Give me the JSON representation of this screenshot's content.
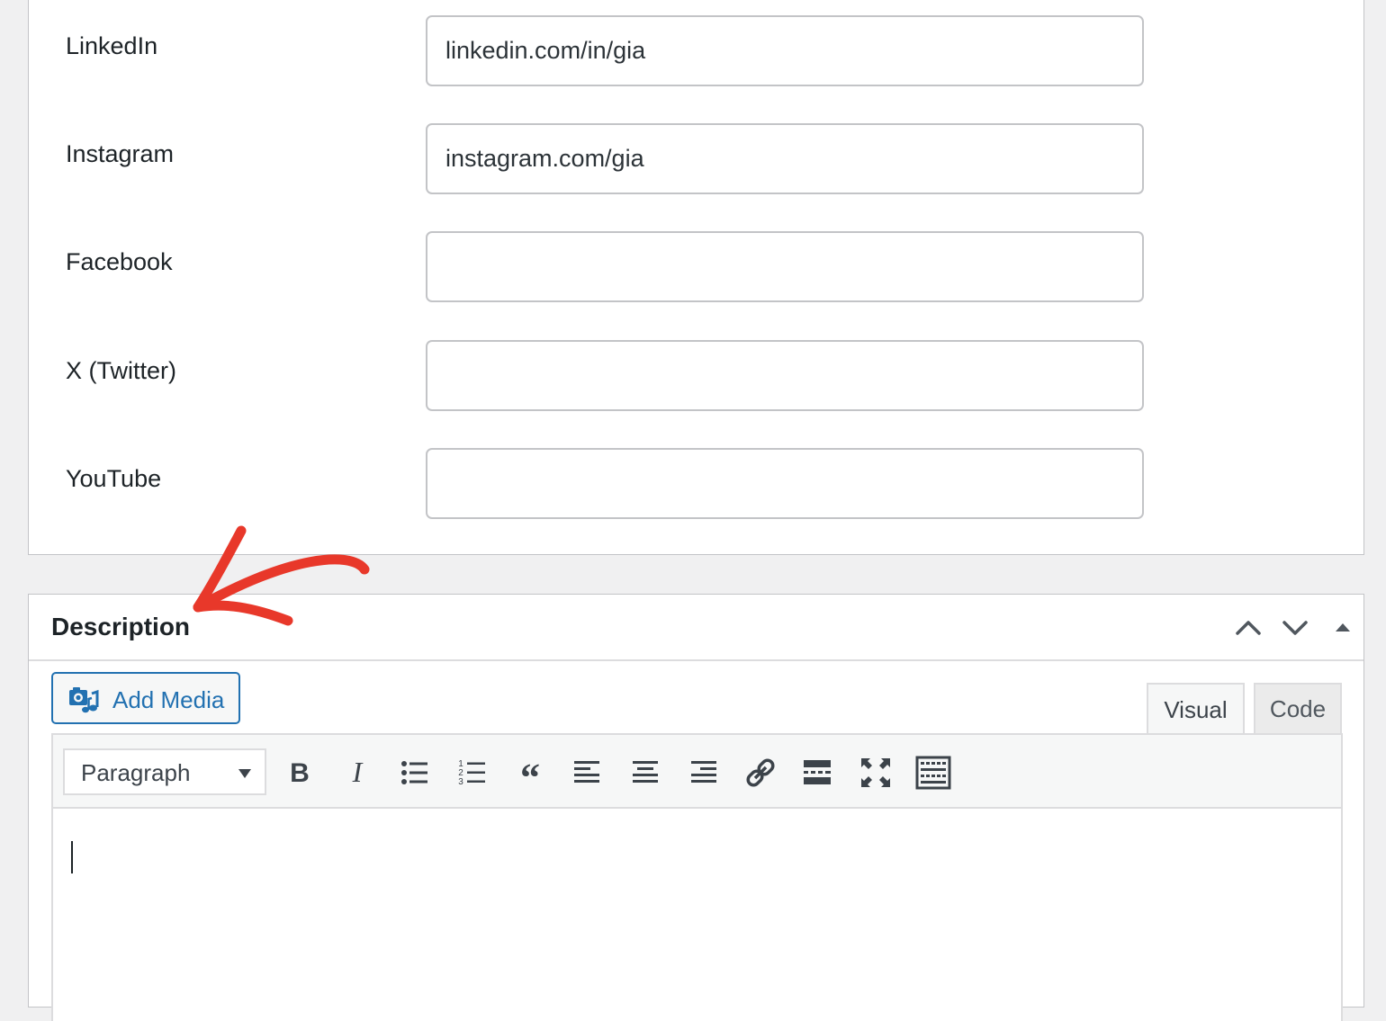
{
  "fields": [
    {
      "label": "LinkedIn",
      "value": "linkedin.com/in/gia"
    },
    {
      "label": "Instagram",
      "value": "instagram.com/gia"
    },
    {
      "label": "Facebook",
      "value": ""
    },
    {
      "label": "X (Twitter)",
      "value": ""
    },
    {
      "label": "YouTube",
      "value": ""
    }
  ],
  "description": {
    "title": "Description",
    "add_media_label": "Add Media",
    "tabs": {
      "visual": "Visual",
      "code": "Code"
    },
    "format_select": "Paragraph",
    "toolbar_icons": [
      "bold-icon",
      "italic-icon",
      "bullet-list-icon",
      "numbered-list-icon",
      "blockquote-icon",
      "align-left-icon",
      "align-center-icon",
      "align-right-icon",
      "link-icon",
      "read-more-icon",
      "fullscreen-icon",
      "toolbar-toggle-icon"
    ],
    "header_icons": [
      "move-up-icon",
      "move-down-icon",
      "collapse-toggle-icon"
    ]
  },
  "colors": {
    "accent": "#2271b1",
    "annotation": "#e8382a",
    "border": "#c3c4c7",
    "background": "#f0f0f1"
  }
}
